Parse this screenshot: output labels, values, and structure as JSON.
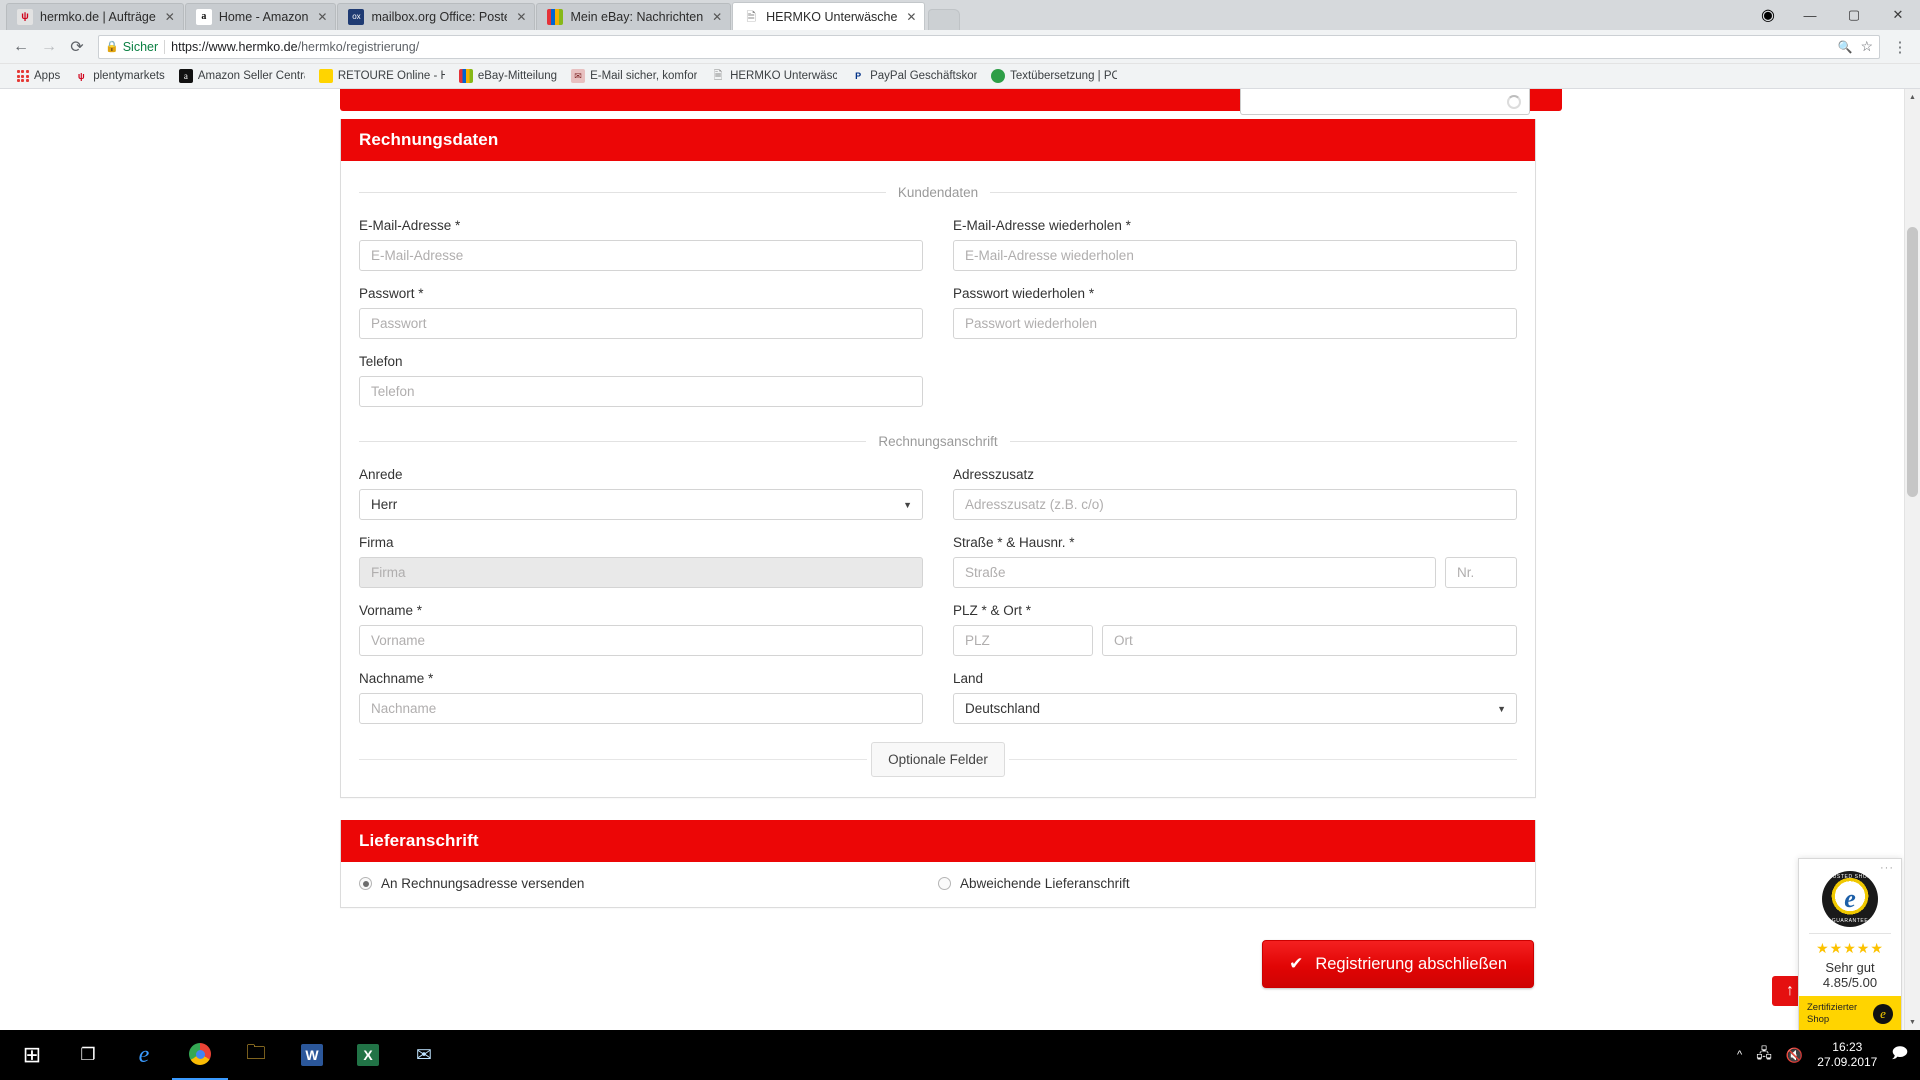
{
  "browser": {
    "tabs": [
      {
        "title": "hermko.de | Aufträge",
        "favicon": "hermko-icon",
        "active": false
      },
      {
        "title": "Home - Amazon",
        "favicon": "amazon-icon",
        "active": false
      },
      {
        "title": "mailbox.org Office: Poste",
        "favicon": "mailbox-icon",
        "active": false
      },
      {
        "title": "Mein eBay: Nachrichten",
        "favicon": "ebay-icon",
        "active": false
      },
      {
        "title": "HERMKO Unterwäsche",
        "favicon": "page-icon",
        "active": true
      }
    ],
    "tab_close_label": "✕",
    "nav": {
      "back": "←",
      "forward": "→",
      "reload": "⟳"
    },
    "omnibox": {
      "secure_label": "Sicher",
      "url_scheme": "https://www.hermko.de",
      "url_path": "/hermko/registrierung/",
      "star": "☆",
      "zoom_icon": "🔍"
    },
    "menu_label": "⋮",
    "window": {
      "minimize": "—",
      "maximize": "▢",
      "close": "✕",
      "profile": "◉"
    },
    "bookmarks": [
      {
        "label": "Apps",
        "icon": "apps-grid-icon"
      },
      {
        "label": "plentymarkets",
        "icon": "plentymarkets-icon"
      },
      {
        "label": "Amazon Seller Centra",
        "icon": "amazon-icon"
      },
      {
        "label": "RETOURE Online - HE",
        "icon": "retoure-icon"
      },
      {
        "label": "eBay-Mitteilung",
        "icon": "ebay-icon"
      },
      {
        "label": "E-Mail sicher, komfor",
        "icon": "mail-icon"
      },
      {
        "label": "HERMKO Unterwäsch",
        "icon": "page-icon"
      },
      {
        "label": "PayPal Geschäftskont",
        "icon": "paypal-icon"
      },
      {
        "label": "Textübersetzung | PO",
        "icon": "translate-icon"
      }
    ]
  },
  "page": {
    "billing_panel": {
      "title": "Rechnungsdaten",
      "legend_customer": "Kundendaten",
      "legend_address": "Rechnungsanschrift",
      "fields": {
        "email": {
          "label": "E-Mail-Adresse *",
          "placeholder": "E-Mail-Adresse",
          "value": ""
        },
        "email_repeat": {
          "label": "E-Mail-Adresse wiederholen *",
          "placeholder": "E-Mail-Adresse wiederholen",
          "value": ""
        },
        "password": {
          "label": "Passwort *",
          "placeholder": "Passwort",
          "value": ""
        },
        "password_repeat": {
          "label": "Passwort wiederholen *",
          "placeholder": "Passwort wiederholen",
          "value": ""
        },
        "phone": {
          "label": "Telefon",
          "placeholder": "Telefon",
          "value": ""
        },
        "salutation": {
          "label": "Anrede",
          "selected": "Herr"
        },
        "address_extra": {
          "label": "Adresszusatz",
          "placeholder": "Adresszusatz (z.B. c/o)",
          "value": ""
        },
        "company": {
          "label": "Firma",
          "placeholder": "Firma",
          "value": "",
          "disabled": true
        },
        "street": {
          "label": "Straße * & Hausnr. *",
          "placeholder": "Straße",
          "value": ""
        },
        "house_no": {
          "placeholder": "Nr.",
          "value": ""
        },
        "first_name": {
          "label": "Vorname *",
          "placeholder": "Vorname",
          "value": ""
        },
        "zip": {
          "label": "PLZ * & Ort *",
          "placeholder": "PLZ",
          "value": ""
        },
        "city": {
          "placeholder": "Ort",
          "value": ""
        },
        "last_name": {
          "label": "Nachname *",
          "placeholder": "Nachname",
          "value": ""
        },
        "country": {
          "label": "Land",
          "selected": "Deutschland"
        }
      },
      "optional_fields_button": "Optionale Felder"
    },
    "shipping_panel": {
      "title": "Lieferanschrift",
      "options": [
        {
          "label": "An Rechnungsadresse versenden",
          "selected": true
        },
        {
          "label": "Abweichende Lieferanschrift",
          "selected": false
        }
      ]
    },
    "submit_button": {
      "label": "Registrierung abschließen",
      "icon": "check-icon"
    },
    "back_to_top": "↑",
    "trusted_shops": {
      "seal_top": "TRUSTED SHOPS",
      "seal_bottom": "GUARANTEE",
      "seal_letter": "e",
      "stars": "★★★★★",
      "rating_text": "Sehr gut",
      "rating_value": "4.85/5.00",
      "certified_label": "Zertifizierter Shop",
      "more_dots": "···"
    },
    "accent_color": "#ec0606",
    "caret": "▼"
  },
  "taskbar": {
    "start": "⊞",
    "task_view": "❐",
    "apps": [
      {
        "name": "edge-icon",
        "glyph": "e",
        "color": "#3b9bff"
      },
      {
        "name": "chrome-icon",
        "glyph": "◉",
        "color": "#f4c20d"
      },
      {
        "name": "explorer-icon",
        "glyph": "🗀",
        "color": "#ffc83d"
      },
      {
        "name": "word-icon",
        "glyph": "W",
        "color": "#2b579a"
      },
      {
        "name": "excel-icon",
        "glyph": "X",
        "color": "#217346"
      },
      {
        "name": "mail-icon",
        "glyph": "✉",
        "color": "#0078d7"
      }
    ],
    "tray": {
      "chevron": "^",
      "network_icon": "🖧",
      "volume_icon": "🔇",
      "time": "16:23",
      "date": "27.09.2017",
      "action_center": "🗩"
    }
  }
}
